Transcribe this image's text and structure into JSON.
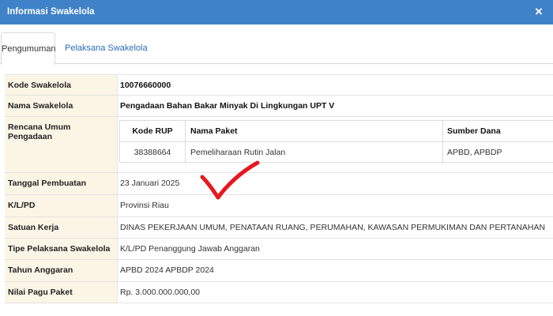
{
  "window": {
    "title": "Informasi Swakelola",
    "close_glyph": "×"
  },
  "tabs": [
    {
      "label": "Pengumuman",
      "active": true
    },
    {
      "label": "Pelaksana Swakelola",
      "active": false
    }
  ],
  "fields": {
    "kode_swakelola": {
      "label": "Kode Swakelola",
      "value": "10076660000"
    },
    "nama_swakelola": {
      "label": "Nama Swakelola",
      "value": "Pengadaan Bahan Bakar Minyak Di Lingkungan UPT V"
    },
    "rup": {
      "label": "Rencana Umum Pengadaan",
      "columns": [
        "Kode RUP",
        "Nama Paket",
        "Sumber Dana"
      ],
      "rows": [
        {
          "kode": "38388664",
          "nama": "Pemeliharaan Rutin Jalan",
          "sumber": "APBD, APBDP"
        }
      ]
    },
    "tanggal": {
      "label": "Tanggal Pembuatan",
      "value": "23 Januari 2025"
    },
    "klpd": {
      "label": "K/L/PD",
      "value": "Provinsi Riau"
    },
    "satker": {
      "label": "Satuan Kerja",
      "value": "DINAS PEKERJAAN UMUM, PENATAAN RUANG, PERUMAHAN, KAWASAN PERMUKIMAN DAN PERTANAHAN"
    },
    "tipe": {
      "label": "Tipe Pelaksana Swakelola",
      "value": "K/L/PD Penanggung Jawab Anggaran"
    },
    "tahun": {
      "label": "Tahun Anggaran",
      "value": "APBD 2024  APBDP 2024"
    },
    "pagu": {
      "label": "Nilai Pagu Paket",
      "value": "Rp. 3.000.000.000,00"
    }
  },
  "annotation": {
    "icon": "red-checkmark-icon",
    "color": "#e5181e"
  },
  "colors": {
    "titlebar": "#3f82c8",
    "label_bg": "#fbf5e6",
    "link": "#2a6db6"
  }
}
